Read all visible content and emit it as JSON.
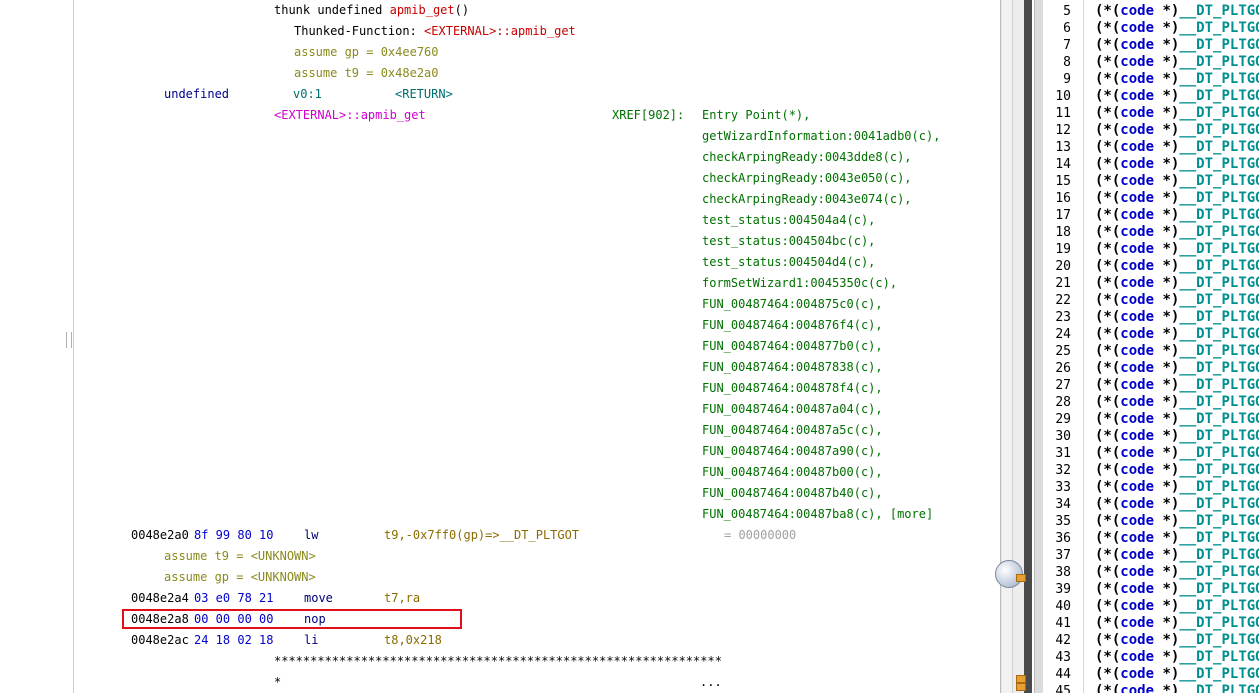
{
  "listing": {
    "thunk_prefix": "thunk undefined ",
    "thunk_name": "apmib_get",
    "thunk_parens": "()",
    "thunked_label": "Thunked-Function: ",
    "thunked_target": "<EXTERNAL>::apmib_get",
    "assume_gp": "assume gp = 0x4ee760",
    "assume_t9": "assume t9 = 0x48e2a0",
    "ret_type": "undefined",
    "ret_storage": "v0:1",
    "ret_name": "<RETURN>",
    "label": "<EXTERNAL>::apmib_get",
    "xref_header": "XREF[902]:",
    "xrefs": [
      "Entry Point(*),",
      "getWizardInformation:0041adb0(c),",
      "checkArpingReady:0043dde8(c),",
      "checkArpingReady:0043e050(c),",
      "checkArpingReady:0043e074(c),",
      "test_status:004504a4(c),",
      "test_status:004504bc(c),",
      "test_status:004504d4(c),",
      "formSetWizard1:0045350c(c),",
      "FUN_00487464:004875c0(c),",
      "FUN_00487464:004876f4(c),",
      "FUN_00487464:004877b0(c),",
      "FUN_00487464:00487838(c),",
      "FUN_00487464:004878f4(c),",
      "FUN_00487464:00487a04(c),",
      "FUN_00487464:00487a5c(c),",
      "FUN_00487464:00487a90(c),",
      "FUN_00487464:00487b00(c),",
      "FUN_00487464:00487b40(c),",
      "FUN_00487464:00487ba8(c), [more]"
    ],
    "instructions": [
      {
        "addr": "0048e2a0",
        "bytes": "8f 99 80 10",
        "mnemonic": "lw",
        "operands": "t9,-0x7ff0(gp)=>__DT_PLTGOT",
        "comment": "= 00000000"
      },
      {
        "addr": "0048e2a4",
        "bytes": "03 e0 78 21",
        "mnemonic": "move",
        "operands": "t7,ra",
        "comment": ""
      },
      {
        "addr": "0048e2a8",
        "bytes": "00 00 00 00",
        "mnemonic": "nop",
        "operands": "",
        "comment": ""
      },
      {
        "addr": "0048e2ac",
        "bytes": "24 18 02 18",
        "mnemonic": "li",
        "operands": "t8,0x218",
        "comment": ""
      }
    ],
    "assume_t9_unknown": "assume t9 = <UNKNOWN>",
    "assume_gp_unknown": "assume gp = <UNKNOWN>",
    "stars": "**************************************************************",
    "star_single": "*",
    "ellipsis": "..."
  },
  "decompiler": {
    "lines": [
      {
        "num": "5",
        "text": "(*(code *)__DT_PLTGOT"
      },
      {
        "num": "6",
        "text": "(*(code *)__DT_PLTGOT"
      },
      {
        "num": "7",
        "text": "(*(code *)__DT_PLTGOT"
      },
      {
        "num": "8",
        "text": "(*(code *)__DT_PLTGOT"
      },
      {
        "num": "9",
        "text": "(*(code *)__DT_PLTGOT"
      },
      {
        "num": "10",
        "text": "(*(code *)__DT_PLTGOT"
      },
      {
        "num": "11",
        "text": "(*(code *)__DT_PLTGOT"
      },
      {
        "num": "12",
        "text": "(*(code *)__DT_PLTGOT"
      },
      {
        "num": "13",
        "text": "(*(code *)__DT_PLTGOT"
      },
      {
        "num": "14",
        "text": "(*(code *)__DT_PLTGOT"
      },
      {
        "num": "15",
        "text": "(*(code *)__DT_PLTGOT"
      },
      {
        "num": "16",
        "text": "(*(code *)__DT_PLTGOT"
      },
      {
        "num": "17",
        "text": "(*(code *)__DT_PLTGOT"
      },
      {
        "num": "18",
        "text": "(*(code *)__DT_PLTGOT"
      },
      {
        "num": "19",
        "text": "(*(code *)__DT_PLTGOT"
      },
      {
        "num": "20",
        "text": "(*(code *)__DT_PLTGOT"
      },
      {
        "num": "21",
        "text": "(*(code *)__DT_PLTGOT"
      },
      {
        "num": "22",
        "text": "(*(code *)__DT_PLTGOT"
      },
      {
        "num": "23",
        "text": "(*(code *)__DT_PLTGOT"
      },
      {
        "num": "24",
        "text": "(*(code *)__DT_PLTGOT"
      },
      {
        "num": "25",
        "text": "(*(code *)__DT_PLTGOT"
      },
      {
        "num": "26",
        "text": "(*(code *)__DT_PLTGOT"
      },
      {
        "num": "27",
        "text": "(*(code *)__DT_PLTGOT"
      },
      {
        "num": "28",
        "text": "(*(code *)__DT_PLTGOT"
      },
      {
        "num": "29",
        "text": "(*(code *)__DT_PLTGOT"
      },
      {
        "num": "30",
        "text": "(*(code *)__DT_PLTGOT"
      },
      {
        "num": "31",
        "text": "(*(code *)__DT_PLTGOT"
      },
      {
        "num": "32",
        "text": "(*(code *)__DT_PLTGOT"
      },
      {
        "num": "33",
        "text": "(*(code *)__DT_PLTGOT"
      },
      {
        "num": "34",
        "text": "(*(code *)__DT_PLTGOT"
      },
      {
        "num": "35",
        "text": "(*(code *)__DT_PLTGOT"
      },
      {
        "num": "36",
        "text": "(*(code *)__DT_PLTGOT"
      },
      {
        "num": "37",
        "text": "(*(code *)__DT_PLTGOT"
      },
      {
        "num": "38",
        "text": "(*(code *)__DT_PLTGOT"
      },
      {
        "num": "39",
        "text": "(*(code *)__DT_PLTGOT"
      },
      {
        "num": "40",
        "text": "(*(code *)__DT_PLTGOT"
      },
      {
        "num": "41",
        "text": "(*(code *)__DT_PLTGOT"
      },
      {
        "num": "42",
        "text": "(*(code *)__DT_PLTGOT"
      },
      {
        "num": "43",
        "text": "(*(code *)__DT_PLTGOT"
      },
      {
        "num": "44",
        "text": "(*(code *)__DT_PLTGOT"
      },
      {
        "num": "45",
        "text": "(*(code *)__DT_PLTGOT"
      }
    ]
  },
  "colors": {
    "selection_box": "#e0101a",
    "row_highlight": "#e8f0fb",
    "keyword_code": "#0000c8",
    "symbol": "#009090"
  }
}
